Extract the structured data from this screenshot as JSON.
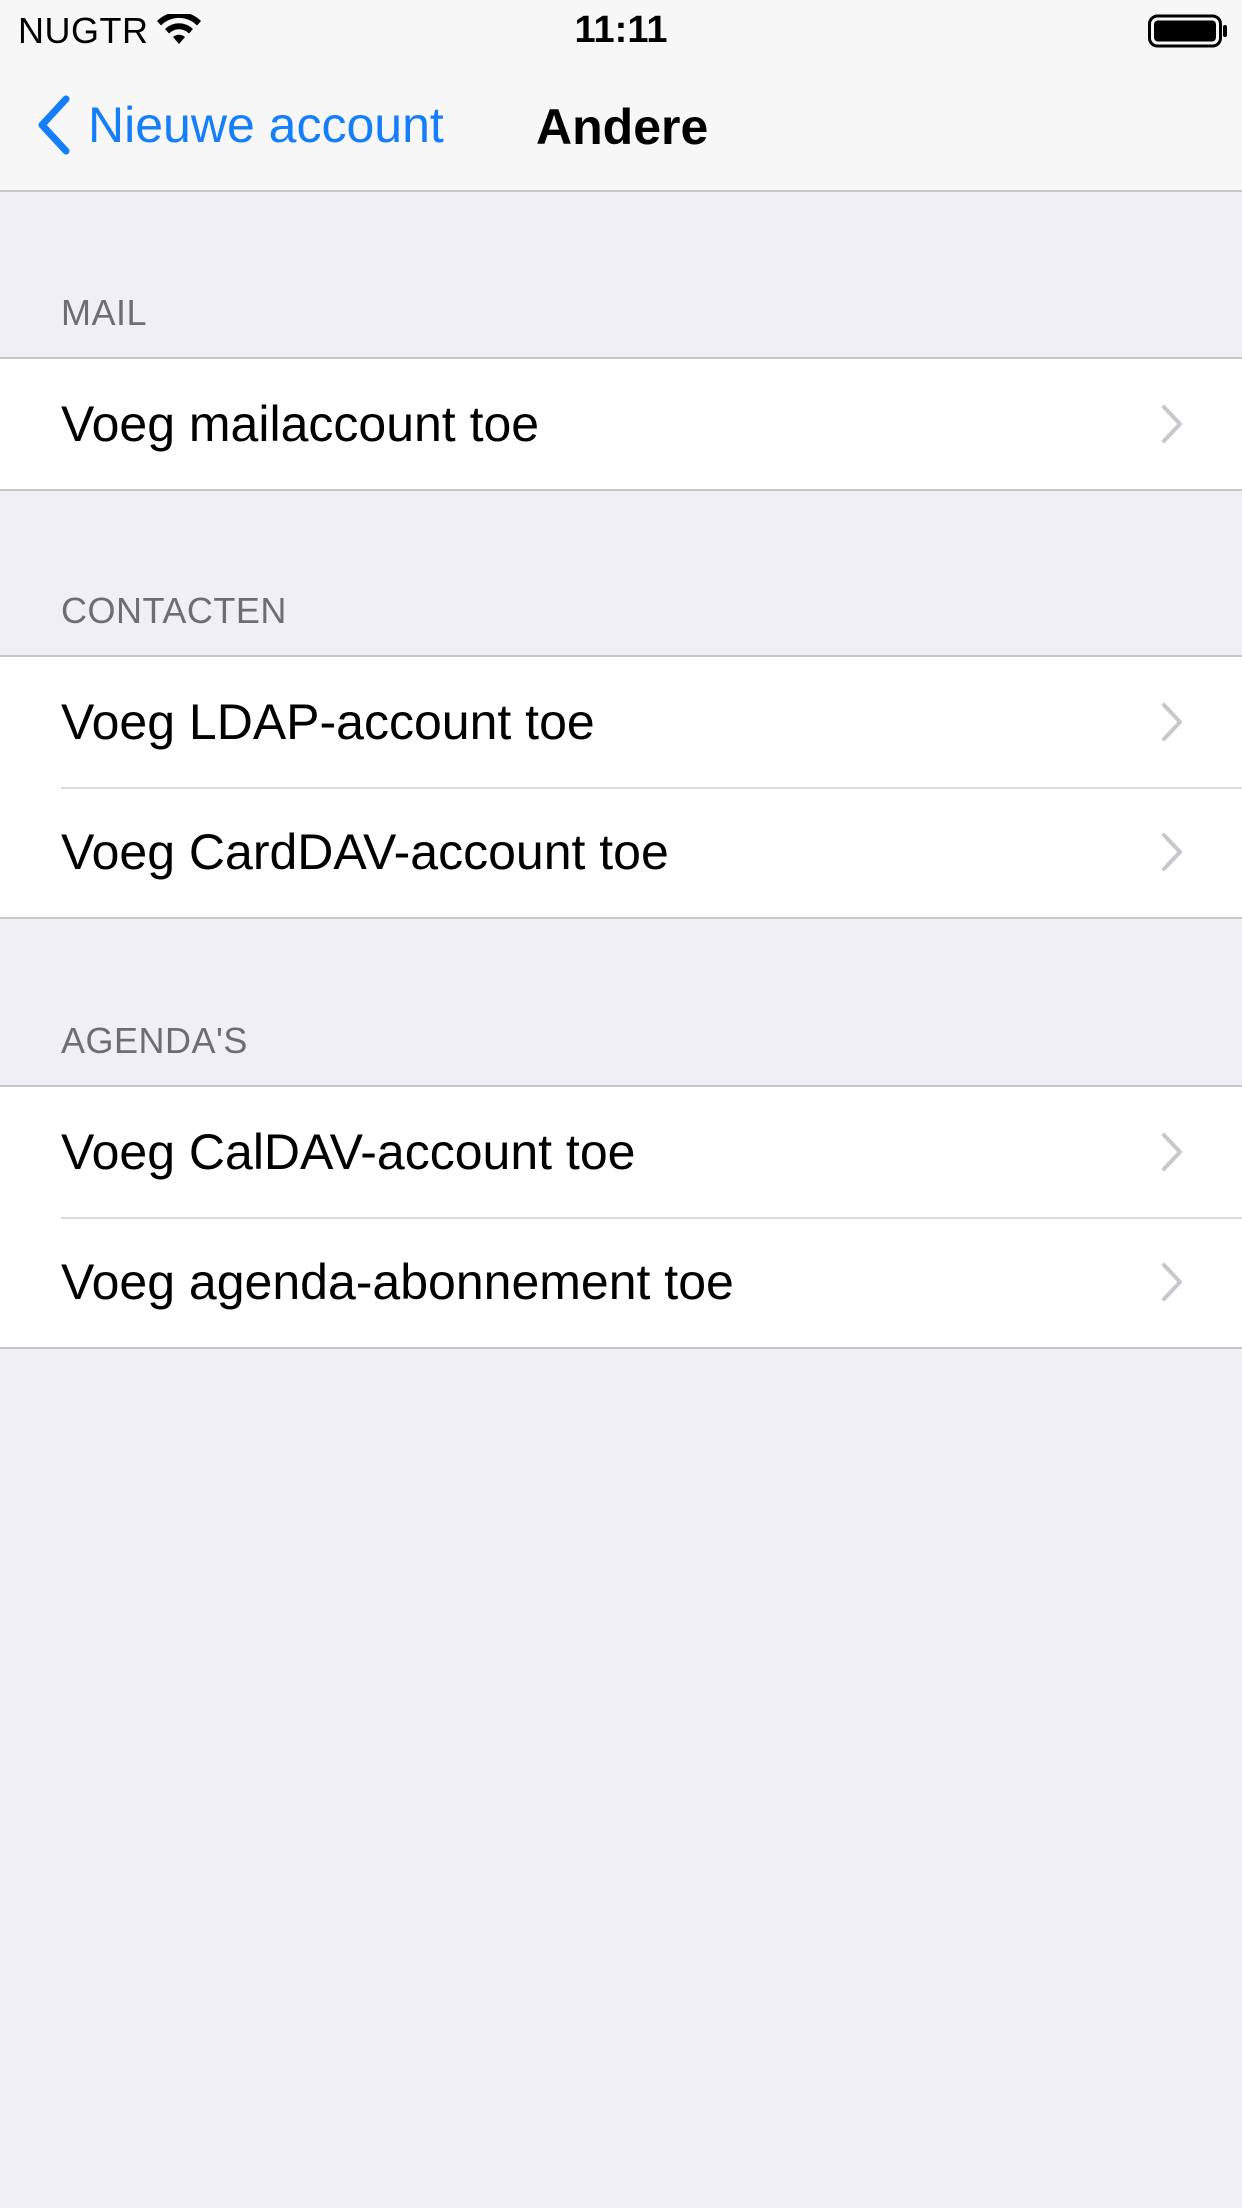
{
  "status_bar": {
    "carrier": "NUGTR",
    "time": "11:11"
  },
  "nav": {
    "back_label": "Nieuwe account",
    "title": "Andere"
  },
  "sections": [
    {
      "header": "MAIL",
      "items": [
        "Voeg mailaccount toe"
      ]
    },
    {
      "header": "CONTACTEN",
      "items": [
        "Voeg LDAP-account toe",
        "Voeg CardDAV-account toe"
      ]
    },
    {
      "header": "AGENDA'S",
      "items": [
        "Voeg CalDAV-account toe",
        "Voeg agenda-abonnement toe"
      ]
    }
  ],
  "colors": {
    "accent": "#147efb",
    "background": "#efeff4",
    "bar_background": "#f7f7f7",
    "section_header": "#6d6d72",
    "chevron": "#c7c7cc"
  },
  "icons": {
    "wifi": "wifi-icon",
    "battery": "battery-icon",
    "back": "chevron-left-icon",
    "disclosure": "chevron-right-icon"
  }
}
